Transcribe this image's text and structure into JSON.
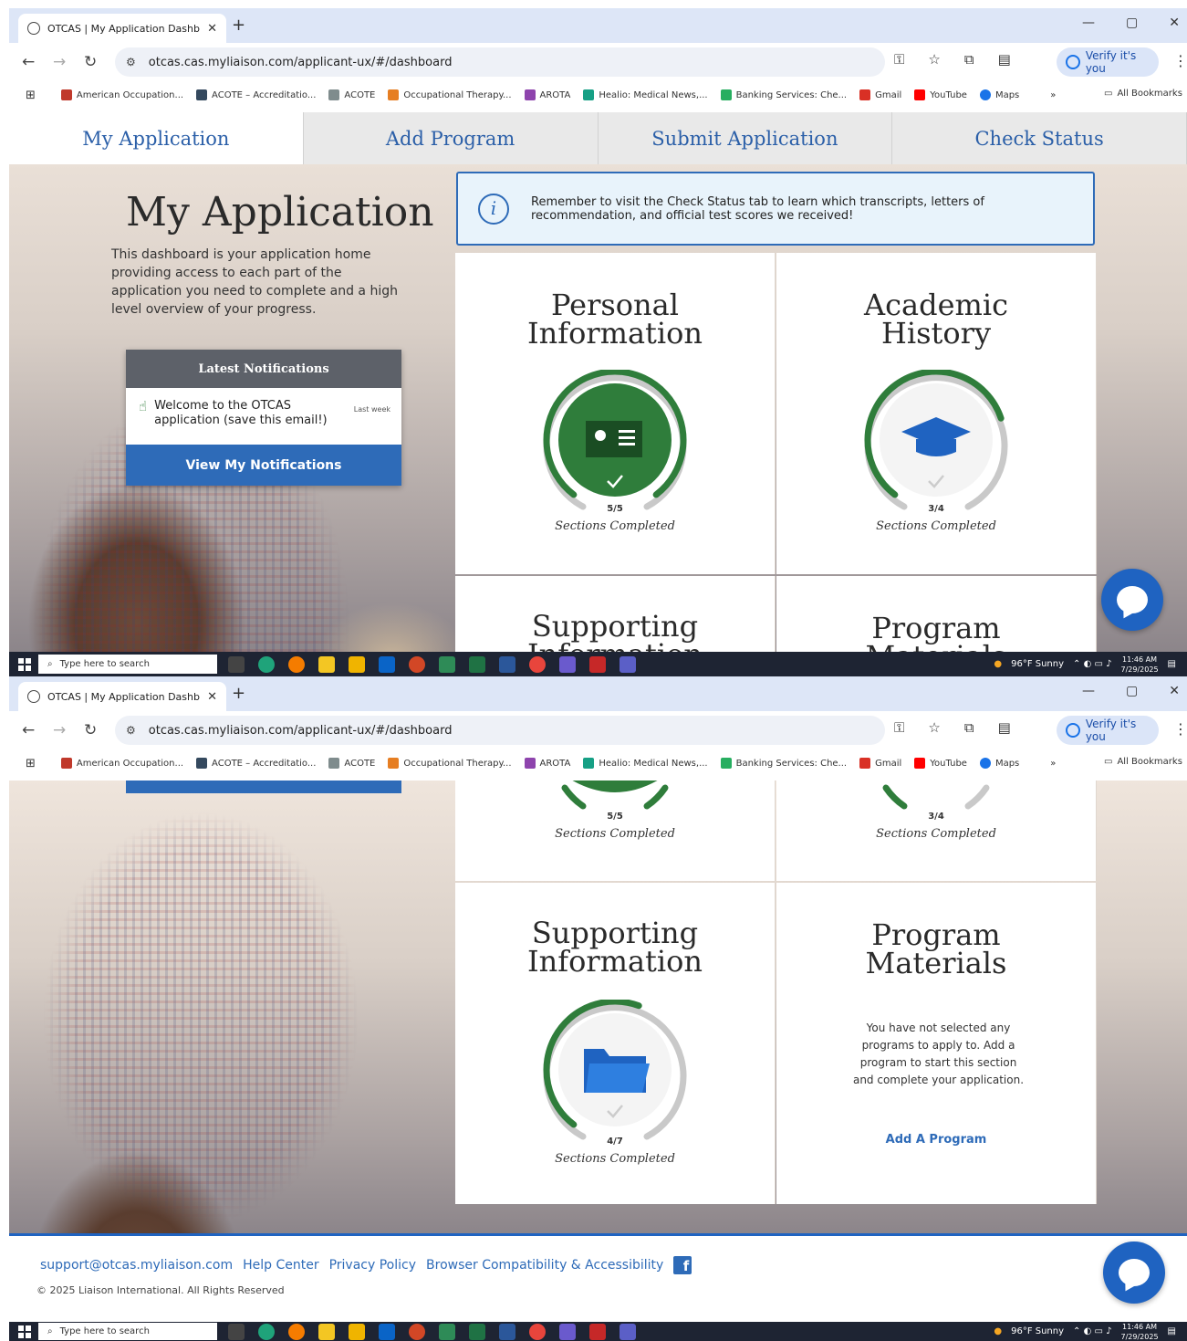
{
  "browser": {
    "tab_title": "OTCAS | My Application Dashboard",
    "new_tab": "+",
    "url": "otcas.cas.myliaison.com/applicant-ux/#/dashboard",
    "verify_label": "Verify it's you",
    "bookmarks": [
      {
        "label": "American Occupation...",
        "color": "#c0392b"
      },
      {
        "label": "ACOTE – Accreditatio...",
        "color": "#34495e"
      },
      {
        "label": "ACOTE",
        "color": "#7f8c8d"
      },
      {
        "label": "Occupational Therapy...",
        "color": "#e67e22"
      },
      {
        "label": "AROTA",
        "color": "#8e44ad"
      },
      {
        "label": "Healio: Medical News,...",
        "color": "#16a085"
      },
      {
        "label": "Banking Services: Che...",
        "color": "#27ae60"
      },
      {
        "label": "Gmail",
        "color": "#d93025"
      },
      {
        "label": "YouTube",
        "color": "#ff0000"
      },
      {
        "label": "Maps",
        "color": "#1a73e8"
      }
    ],
    "more_bookmarks": "»",
    "all_bookmarks": "All Bookmarks"
  },
  "nav": {
    "tabs": [
      "My Application",
      "Add Program",
      "Submit Application",
      "Check Status"
    ]
  },
  "hero": {
    "title": "My Application",
    "description": "This dashboard is your application home providing access to each part of the application you need to complete and a high level overview of your progress."
  },
  "notifications": {
    "header": "Latest Notifications",
    "item_text": "Welcome to the OTCAS application (save this email!)",
    "item_time": "Last week",
    "button": "View My Notifications"
  },
  "banner": {
    "text": "Remember to visit the Check Status tab to learn which transcripts, letters of recommendation, and official test scores we received!"
  },
  "cards": {
    "sections_label": "Sections Completed",
    "personal": {
      "title_1": "Personal",
      "title_2": "Information",
      "completed": 5,
      "total": 5,
      "count": "5/5"
    },
    "academic": {
      "title_1": "Academic",
      "title_2": "History",
      "completed": 3,
      "total": 4,
      "count": "3/4"
    },
    "supporting": {
      "title_1": "Supporting",
      "title_2": "Information",
      "completed": 4,
      "total": 7,
      "count": "4/7"
    },
    "program": {
      "title_1": "Program",
      "title_2": "Materials",
      "message": "You have not selected any programs to apply to. Add a program to start this section and complete your application.",
      "link": "Add A Program"
    }
  },
  "footer": {
    "email": "support@otcas.myliaison.com",
    "help": "Help Center",
    "privacy": "Privacy Policy",
    "compat": "Browser Compatibility & Accessibility",
    "copyright": "© 2025 Liaison International. All Rights Reserved"
  },
  "taskbar": {
    "search": "Type here to search",
    "weather": "96°F Sunny",
    "time": "11:46 AM",
    "date": "7/29/2025"
  },
  "colors": {
    "accent": "#2e6bb8",
    "progress_green": "#2f7d3b",
    "progress_gray": "#c9c9c9"
  }
}
